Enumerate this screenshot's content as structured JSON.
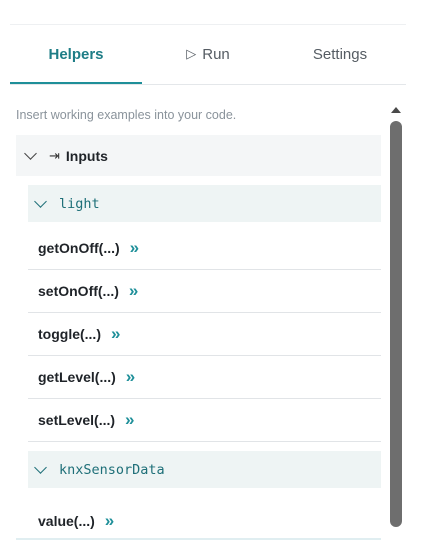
{
  "tabs": {
    "helpers": "Helpers",
    "run": "Run",
    "run_icon": "▷",
    "settings": "Settings"
  },
  "hint": "Insert working examples into your code.",
  "inputs_section": {
    "label": "Inputs",
    "icon": "⇥",
    "icon_name": "input-icon"
  },
  "groups": [
    {
      "name": "light",
      "methods": [
        "getOnOff(...)",
        "setOnOff(...)",
        "toggle(...)",
        "getLevel(...)",
        "setLevel(...)"
      ]
    },
    {
      "name": "knxSensorData",
      "methods": [
        "value(...)"
      ]
    }
  ],
  "insert_arrow": "»",
  "colors": {
    "accent": "#1e8f99",
    "group_text": "#1e6f78",
    "section_bg": "#f4f6f7"
  }
}
